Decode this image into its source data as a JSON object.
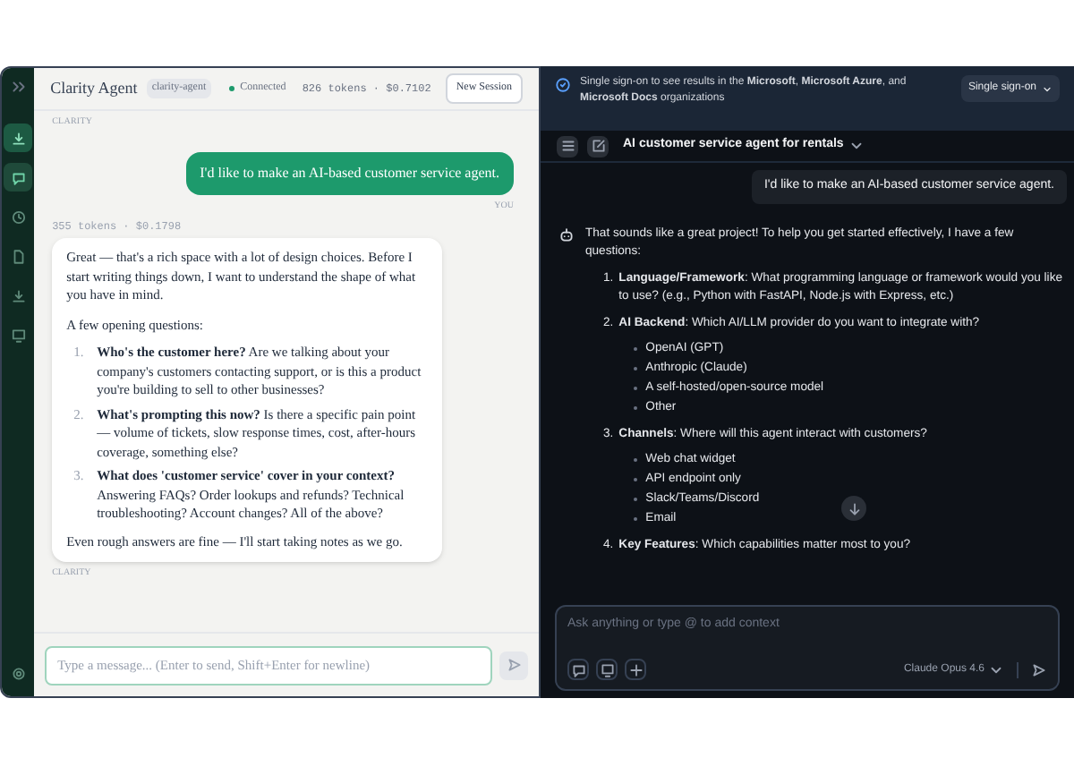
{
  "left_app": {
    "sidebar": {
      "items": [
        {
          "selected": false
        },
        {
          "selected": true
        },
        {
          "selected": false
        },
        {
          "selected": false
        },
        {
          "selected": false
        },
        {
          "selected": false
        }
      ]
    },
    "header": {
      "title": "Clarity Agent",
      "badge": "clarity-agent",
      "status": "Connected",
      "usage": "826 tokens · $0.7102",
      "button": "New Session"
    },
    "top_label": "CLARITY",
    "messages": [
      {
        "kind": "user",
        "text": "I'd like to make an AI-based customer service agent.",
        "label": "YOU"
      },
      {
        "kind": "assistant",
        "meta": "355 tokens · $0.1798",
        "intro": "Great — that's a rich space with a lot of design choices. Before I start writing things down, I want to understand the shape of what you have in mind.",
        "lead": "A few opening questions:",
        "items": [
          {
            "number": "1.",
            "text": "**Who's the customer here?** Are we talking about your company's customers contacting support, or is this a product you're building to sell to other businesses?"
          },
          {
            "number": "2.",
            "text": "**What's prompting this now?** Is there a specific pain point — volume of tickets, slow response times, cost, after-hours coverage, something else?"
          },
          {
            "number": "3.",
            "text": "**What does 'customer service' cover in your context?** Answering FAQs? Order lookups and refunds? Technical troubleshooting? Account changes? All of the above?"
          }
        ],
        "closing": "Even rough answers are fine — I'll start taking notes as we go.",
        "label": "CLARITY"
      }
    ],
    "composer": {
      "placeholder": "Type a message... (Enter to send, Shift+Enter for newline)"
    }
  },
  "right_app": {
    "banner": {
      "text": "Single sign-on to see results in the **Microsoft**, **Microsoft Azure**, and **Microsoft Docs** organizations",
      "button": "Single sign-on"
    },
    "toolbar": {
      "title": "AI customer service agent for rentals"
    },
    "user_message": "I'd like to make an AI-based customer service agent.",
    "reply": {
      "intro": "That sounds like a great project! To help you get started effectively, I have a few questions:",
      "items": [
        {
          "number": "1.",
          "text": "**Language/Framework**: What programming language or framework would you like to use? (e.g., Python with FastAPI, Node.js with Express, etc.)"
        },
        {
          "number": "2.",
          "text": "**AI Backend**: Which AI/LLM provider do you want to integrate with?",
          "bullets": [
            "OpenAI (GPT)",
            "Anthropic (Claude)",
            "A self-hosted/open-source model",
            "Other"
          ]
        },
        {
          "number": "3.",
          "text": "**Channels**: Where will this agent interact with customers?",
          "bullets": [
            "Web chat widget",
            "API endpoint only",
            "Slack/Teams/Discord",
            "Email"
          ]
        },
        {
          "number": "4.",
          "text": "**Key Features**: Which capabilities matter most to you?"
        }
      ]
    },
    "composer": {
      "placeholder": "Ask anything or type @ to add context",
      "model": "Claude Opus 4.6"
    }
  }
}
